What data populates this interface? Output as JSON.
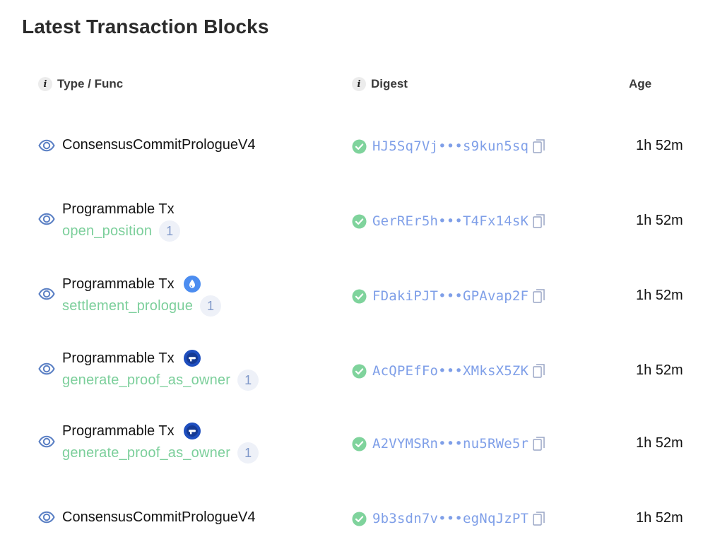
{
  "title": "Latest Transaction Blocks",
  "columns": {
    "type": "Type / Func",
    "digest": "Digest",
    "age": "Age"
  },
  "colors": {
    "function_green": "#7ccf9b",
    "digest_blue": "#7f9fe8",
    "success_green": "#7fd39c",
    "eye_blue": "#5a7fc4"
  },
  "rows": [
    {
      "type": "ConsensusCommitPrologueV4",
      "func": "",
      "count": "",
      "project_icon": "",
      "digest": "HJ5Sq7Vj•••s9kun5sq",
      "age": "1h 52m"
    },
    {
      "type": "Programmable Tx",
      "func": "open_position",
      "count": "1",
      "project_icon": "",
      "digest": "GerREr5h•••T4Fx14sK",
      "age": "1h 52m"
    },
    {
      "type": "Programmable Tx",
      "func": "settlement_prologue",
      "count": "1",
      "project_icon": "droplet-icon",
      "digest": "FDakiPJT•••GPAvap2F",
      "age": "1h 52m"
    },
    {
      "type": "Programmable Tx",
      "func": "generate_proof_as_owner",
      "count": "1",
      "project_icon": "project-logo-icon",
      "digest": "AcQPEfFo•••XMksX5ZK",
      "age": "1h 52m"
    },
    {
      "type": "Programmable Tx",
      "func": "generate_proof_as_owner",
      "count": "1",
      "project_icon": "project-logo-icon",
      "digest": "A2VYMSRn•••nu5RWe5r",
      "age": "1h 52m"
    },
    {
      "type": "ConsensusCommitPrologueV4",
      "func": "",
      "count": "",
      "project_icon": "",
      "digest": "9b3sdn7v•••egNqJzPT",
      "age": "1h 52m"
    }
  ]
}
